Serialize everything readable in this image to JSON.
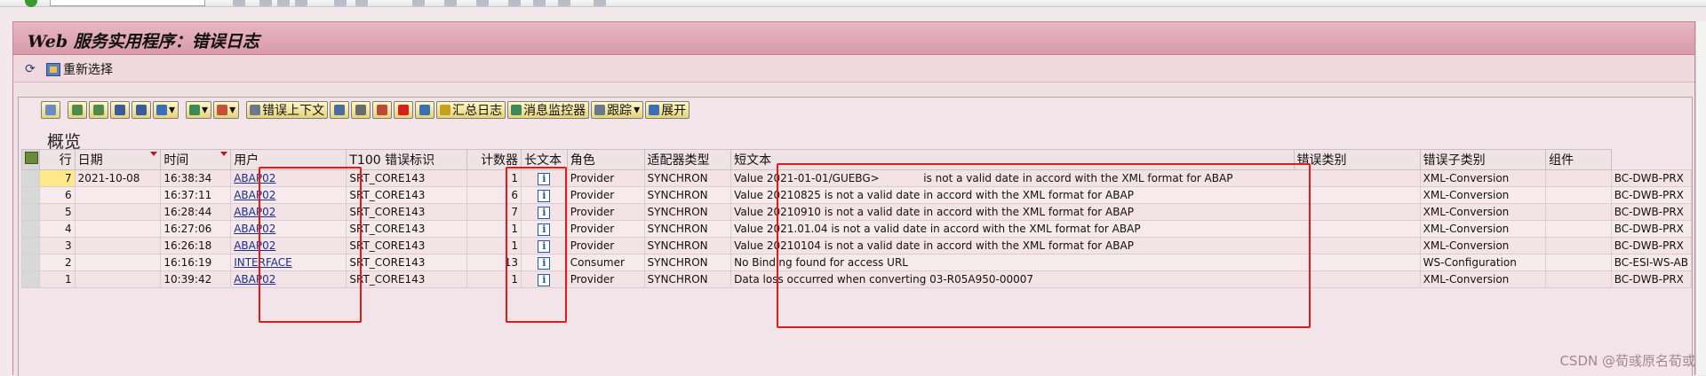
{
  "window": {
    "title": "Web 服务实用程序：错误日志"
  },
  "app_toolbar": {
    "reselect_label": "重新选择"
  },
  "alv_toolbar": {
    "buttons": [
      {
        "label": "错误上下文"
      },
      {
        "label": "汇总日志"
      },
      {
        "label": "消息监控器"
      },
      {
        "label": "跟踪"
      },
      {
        "label": "展开"
      }
    ]
  },
  "section_title": "概览",
  "table": {
    "columns": [
      "行",
      "日期",
      "时间",
      "用户",
      "T100 错误标识",
      "计数器",
      "长文本",
      "角色",
      "适配器类型",
      "短文本",
      "错误类别",
      "错误子类别",
      "组件"
    ],
    "rows": [
      {
        "row": "7",
        "date": "2021-10-08",
        "time": "16:38:34",
        "user": "ABAP02",
        "t100": "SRT_CORE143",
        "counter": "1",
        "role": "Provider",
        "adapter": "SYNCHRON",
        "short_text": "Value 2021-01-01/GUEBG>             is not a valid date in accord with the XML format for ABAP",
        "category": "XML-Conversion",
        "subcategory": "",
        "component": "BC-DWB-PRX"
      },
      {
        "row": "6",
        "date": "",
        "time": "16:37:11",
        "user": "ABAP02",
        "t100": "SRT_CORE143",
        "counter": "6",
        "role": "Provider",
        "adapter": "SYNCHRON",
        "short_text": "Value 20210825 is not a valid date in accord with the XML format for ABAP",
        "category": "XML-Conversion",
        "subcategory": "",
        "component": "BC-DWB-PRX"
      },
      {
        "row": "5",
        "date": "",
        "time": "16:28:44",
        "user": "ABAP02",
        "t100": "SRT_CORE143",
        "counter": "7",
        "role": "Provider",
        "adapter": "SYNCHRON",
        "short_text": "Value 20210910 is not a valid date in accord with the XML format for ABAP",
        "category": "XML-Conversion",
        "subcategory": "",
        "component": "BC-DWB-PRX"
      },
      {
        "row": "4",
        "date": "",
        "time": "16:27:06",
        "user": "ABAP02",
        "t100": "SRT_CORE143",
        "counter": "1",
        "role": "Provider",
        "adapter": "SYNCHRON",
        "short_text": "Value 2021.01.04 is not a valid date in accord with the XML format for ABAP",
        "category": "XML-Conversion",
        "subcategory": "",
        "component": "BC-DWB-PRX"
      },
      {
        "row": "3",
        "date": "",
        "time": "16:26:18",
        "user": "ABAP02",
        "t100": "SRT_CORE143",
        "counter": "1",
        "role": "Provider",
        "adapter": "SYNCHRON",
        "short_text": "Value 20210104 is not a valid date in accord with the XML format for ABAP",
        "category": "XML-Conversion",
        "subcategory": "",
        "component": "BC-DWB-PRX"
      },
      {
        "row": "2",
        "date": "",
        "time": "16:16:19",
        "user": "INTERFACE",
        "t100": "SRT_CORE143",
        "counter": "13",
        "role": "Consumer",
        "adapter": "SYNCHRON",
        "short_text": "No Binding found for access URL",
        "category": "WS-Configuration",
        "subcategory": "",
        "component": "BC-ESI-WS-AB"
      },
      {
        "row": "1",
        "date": "",
        "time": "10:39:42",
        "user": "ABAP02",
        "t100": "SRT_CORE143",
        "counter": "1",
        "role": "Provider",
        "adapter": "SYNCHRON",
        "short_text": "Data loss occurred when converting 03-R05A950-00007",
        "category": "XML-Conversion",
        "subcategory": "",
        "component": "BC-DWB-PRX"
      }
    ]
  },
  "watermark": "CSDN @荀彧原名荀或",
  "colors": {
    "title_bar": "#d99aac",
    "highlight": "#e61919",
    "link": "#1a2f8a"
  }
}
